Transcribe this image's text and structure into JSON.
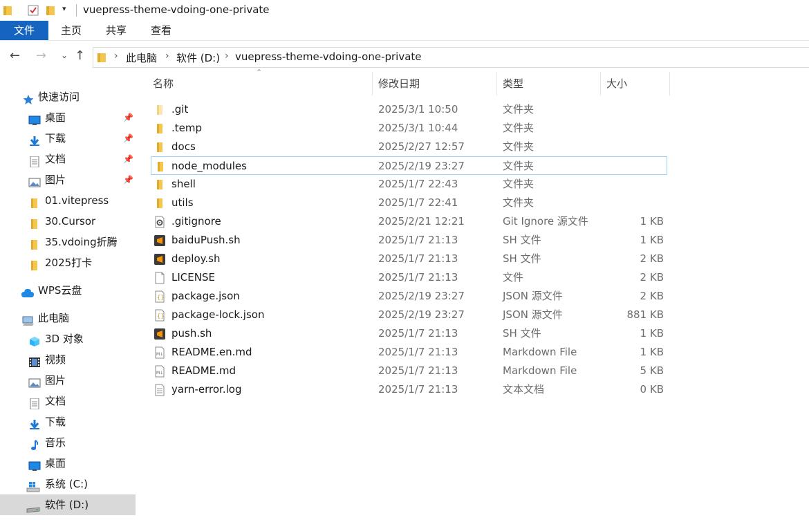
{
  "window": {
    "title": "vuepress-theme-vdoing-one-private"
  },
  "ribbon": {
    "tabs": [
      "文件",
      "主页",
      "共享",
      "查看"
    ]
  },
  "address": {
    "parts": [
      "此电脑",
      "软件 (D:)",
      "vuepress-theme-vdoing-one-private"
    ]
  },
  "sidebar": {
    "quick_access": "快速访问",
    "pinned": [
      {
        "label": "桌面",
        "icon": "desktop-icon"
      },
      {
        "label": "下载",
        "icon": "download-icon"
      },
      {
        "label": "文档",
        "icon": "document-icon"
      },
      {
        "label": "图片",
        "icon": "picture-icon"
      }
    ],
    "recent_folders": [
      "01.vitepress",
      "30.Cursor",
      "35.vdoing折腾",
      "2025打卡"
    ],
    "wps": "WPS云盘",
    "this_pc": "此电脑",
    "pc_items": [
      {
        "label": "3D 对象",
        "icon": "3d-objects-icon"
      },
      {
        "label": "视频",
        "icon": "video-icon"
      },
      {
        "label": "图片",
        "icon": "picture-icon"
      },
      {
        "label": "文档",
        "icon": "document-icon"
      },
      {
        "label": "下载",
        "icon": "download-icon"
      },
      {
        "label": "音乐",
        "icon": "music-icon"
      },
      {
        "label": "桌面",
        "icon": "desktop-icon"
      },
      {
        "label": "系统 (C:)",
        "icon": "windows-drive-icon"
      },
      {
        "label": "软件 (D:)",
        "icon": "drive-icon"
      }
    ]
  },
  "columns": {
    "name": "名称",
    "date": "修改日期",
    "type": "类型",
    "size": "大小"
  },
  "files": [
    {
      "name": ".git",
      "date": "2025/3/1 10:50",
      "type": "文件夹",
      "size": "",
      "icon": "folder-light-icon"
    },
    {
      "name": ".temp",
      "date": "2025/3/1 10:44",
      "type": "文件夹",
      "size": "",
      "icon": "folder-icon"
    },
    {
      "name": "docs",
      "date": "2025/2/27 12:57",
      "type": "文件夹",
      "size": "",
      "icon": "folder-icon"
    },
    {
      "name": "node_modules",
      "date": "2025/2/19 23:27",
      "type": "文件夹",
      "size": "",
      "icon": "folder-icon"
    },
    {
      "name": "shell",
      "date": "2025/1/7 22:43",
      "type": "文件夹",
      "size": "",
      "icon": "folder-icon"
    },
    {
      "name": "utils",
      "date": "2025/1/7 22:41",
      "type": "文件夹",
      "size": "",
      "icon": "folder-icon"
    },
    {
      "name": ".gitignore",
      "date": "2025/2/21 12:21",
      "type": "Git Ignore 源文件",
      "size": "1 KB",
      "icon": "settings-file-icon"
    },
    {
      "name": "baiduPush.sh",
      "date": "2025/1/7 21:13",
      "type": "SH 文件",
      "size": "1 KB",
      "icon": "sublime-icon"
    },
    {
      "name": "deploy.sh",
      "date": "2025/1/7 21:13",
      "type": "SH 文件",
      "size": "2 KB",
      "icon": "sublime-icon"
    },
    {
      "name": "LICENSE",
      "date": "2025/1/7 21:13",
      "type": "文件",
      "size": "2 KB",
      "icon": "blank-file-icon"
    },
    {
      "name": "package.json",
      "date": "2025/2/19 23:27",
      "type": "JSON 源文件",
      "size": "2 KB",
      "icon": "json-file-icon"
    },
    {
      "name": "package-lock.json",
      "date": "2025/2/19 23:27",
      "type": "JSON 源文件",
      "size": "881 KB",
      "icon": "json-file-icon"
    },
    {
      "name": "push.sh",
      "date": "2025/1/7 21:13",
      "type": "SH 文件",
      "size": "1 KB",
      "icon": "sublime-icon"
    },
    {
      "name": "README.en.md",
      "date": "2025/1/7 21:13",
      "type": "Markdown File",
      "size": "1 KB",
      "icon": "markdown-file-icon"
    },
    {
      "name": "README.md",
      "date": "2025/1/7 21:13",
      "type": "Markdown File",
      "size": "5 KB",
      "icon": "markdown-file-icon"
    },
    {
      "name": "yarn-error.log",
      "date": "2025/1/7 21:13",
      "type": "文本文档",
      "size": "0 KB",
      "icon": "text-file-icon"
    }
  ],
  "colors": {
    "accent": "#1565c0",
    "folder": "#f3c74d",
    "selection": "#d9d9d9",
    "focus_border": "#99d1ff"
  }
}
